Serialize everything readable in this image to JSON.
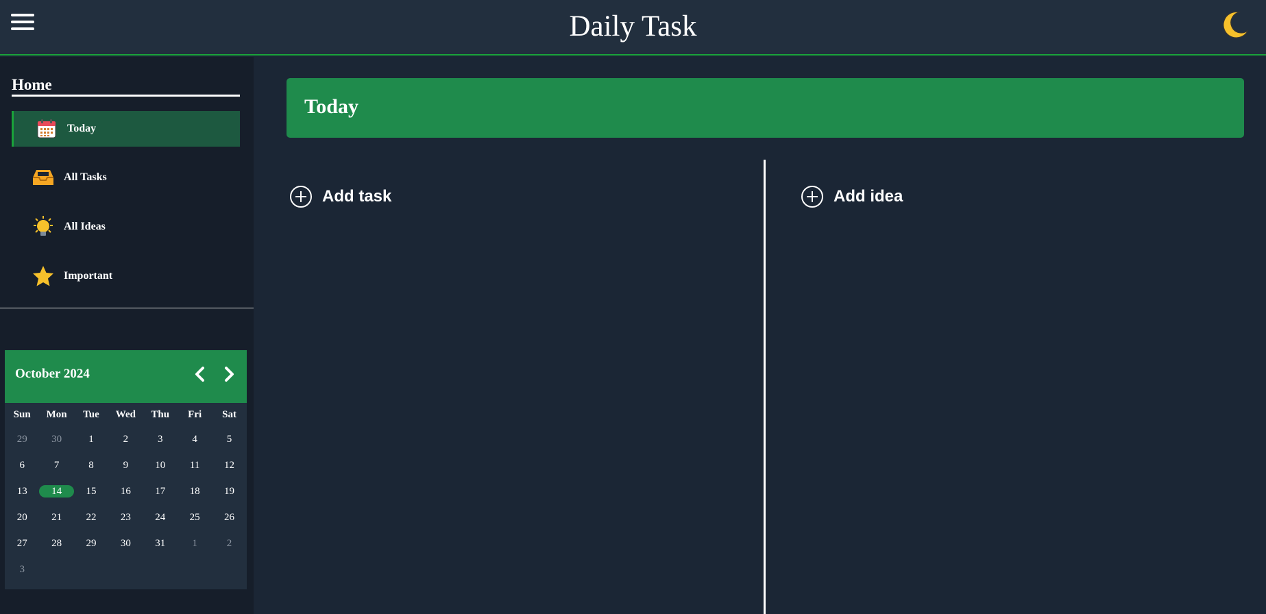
{
  "header": {
    "title": "Daily Task",
    "menu_icon": "hamburger-menu-icon",
    "theme_icon": "moon-icon"
  },
  "sidebar": {
    "section_title": "Home",
    "items": [
      {
        "label": "Today",
        "icon": "calendar-icon",
        "active": true
      },
      {
        "label": "All Tasks",
        "icon": "inbox-tray-icon",
        "active": false
      },
      {
        "label": "All Ideas",
        "icon": "lightbulb-icon",
        "active": false
      },
      {
        "label": "Important",
        "icon": "star-icon",
        "active": false
      }
    ]
  },
  "calendar": {
    "month_label": "October 2024",
    "weekdays": [
      "Sun",
      "Mon",
      "Tue",
      "Wed",
      "Thu",
      "Fri",
      "Sat"
    ],
    "days": [
      {
        "d": "29",
        "muted": true
      },
      {
        "d": "30",
        "muted": true
      },
      {
        "d": "1"
      },
      {
        "d": "2"
      },
      {
        "d": "3"
      },
      {
        "d": "4"
      },
      {
        "d": "5"
      },
      {
        "d": "6"
      },
      {
        "d": "7"
      },
      {
        "d": "8"
      },
      {
        "d": "9"
      },
      {
        "d": "10"
      },
      {
        "d": "11"
      },
      {
        "d": "12"
      },
      {
        "d": "13"
      },
      {
        "d": "14",
        "today": true
      },
      {
        "d": "15"
      },
      {
        "d": "16"
      },
      {
        "d": "17"
      },
      {
        "d": "18"
      },
      {
        "d": "19"
      },
      {
        "d": "20"
      },
      {
        "d": "21"
      },
      {
        "d": "22"
      },
      {
        "d": "23"
      },
      {
        "d": "24"
      },
      {
        "d": "25"
      },
      {
        "d": "26"
      },
      {
        "d": "27"
      },
      {
        "d": "28"
      },
      {
        "d": "29"
      },
      {
        "d": "30"
      },
      {
        "d": "31"
      },
      {
        "d": "1",
        "muted": true
      },
      {
        "d": "2",
        "muted": true
      },
      {
        "d": "3",
        "muted": true
      }
    ]
  },
  "main": {
    "banner_title": "Today",
    "add_task_label": "Add task",
    "add_idea_label": "Add idea"
  },
  "colors": {
    "accent_green": "#1f8b4c",
    "header_bg": "#222f3e",
    "page_bg": "#1b2635",
    "sidebar_bg": "#161e2a"
  }
}
